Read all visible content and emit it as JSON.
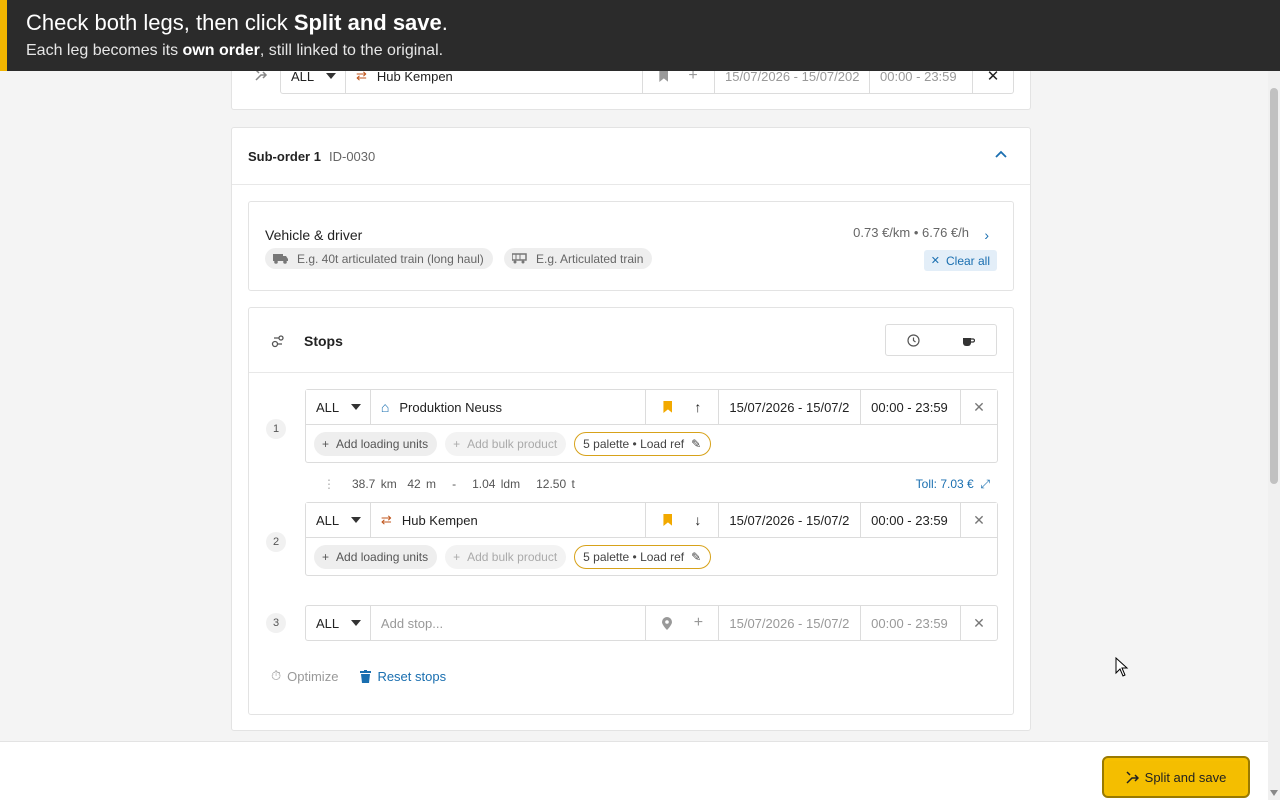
{
  "banner": {
    "line1_pre": "Check both legs, then click ",
    "line1_bold": "Split and save",
    "line1_post": ".",
    "line2_pre": "Each leg becomes its ",
    "line2_bold": "own order",
    "line2_post": ", still linked to the original."
  },
  "top_leg": {
    "type_select": "ALL",
    "location": "Hub Kempen",
    "date_range": "15/07/2026 - 15/07/202",
    "time_range": "00:00 - 23:59"
  },
  "sub_order": {
    "title": "Sub-order 1",
    "id": "ID-0030"
  },
  "vehicle": {
    "title": "Vehicle & driver",
    "vehicle_placeholder": "E.g. 40t articulated train (long haul)",
    "trailer_placeholder": "E.g. Articulated train",
    "rate": "0.73 €/km • 6.76 €/h",
    "clear_all": "Clear all"
  },
  "stops": {
    "title": "Stops",
    "items": [
      {
        "number": "1",
        "type_select": "ALL",
        "location": "Produktion Neuss",
        "date_range": "15/07/2026 - 15/07/2",
        "time_range": "00:00 - 23:59",
        "add_loading_units": "Add loading units",
        "add_bulk_product": "Add bulk product",
        "load_info": "5 palette • Load ref"
      },
      {
        "number": "2",
        "type_select": "ALL",
        "location": "Hub Kempen",
        "date_range": "15/07/2026 - 15/07/2",
        "time_range": "00:00 - 23:59",
        "add_loading_units": "Add loading units",
        "add_bulk_product": "Add bulk product",
        "load_info": "5 palette • Load ref"
      },
      {
        "number": "3",
        "type_select": "ALL",
        "location_placeholder": "Add stop...",
        "date_range": "15/07/2026 - 15/07/2",
        "time_range": "00:00 - 23:59"
      }
    ],
    "segment": {
      "distance": "38.7 km",
      "duration": "42 m",
      "separator": "-",
      "ldm": "1.04 ldm",
      "weight": "12.50 t",
      "toll": "Toll: 7.03 €"
    },
    "optimize": "Optimize",
    "reset_stops": "Reset stops"
  },
  "actions": {
    "split_and_save": "Split and save"
  },
  "colors": {
    "accent": "#f4be00",
    "link": "#1a6fb0",
    "banner_bg": "#2b2b2b",
    "bookmark": "#f2a900"
  }
}
